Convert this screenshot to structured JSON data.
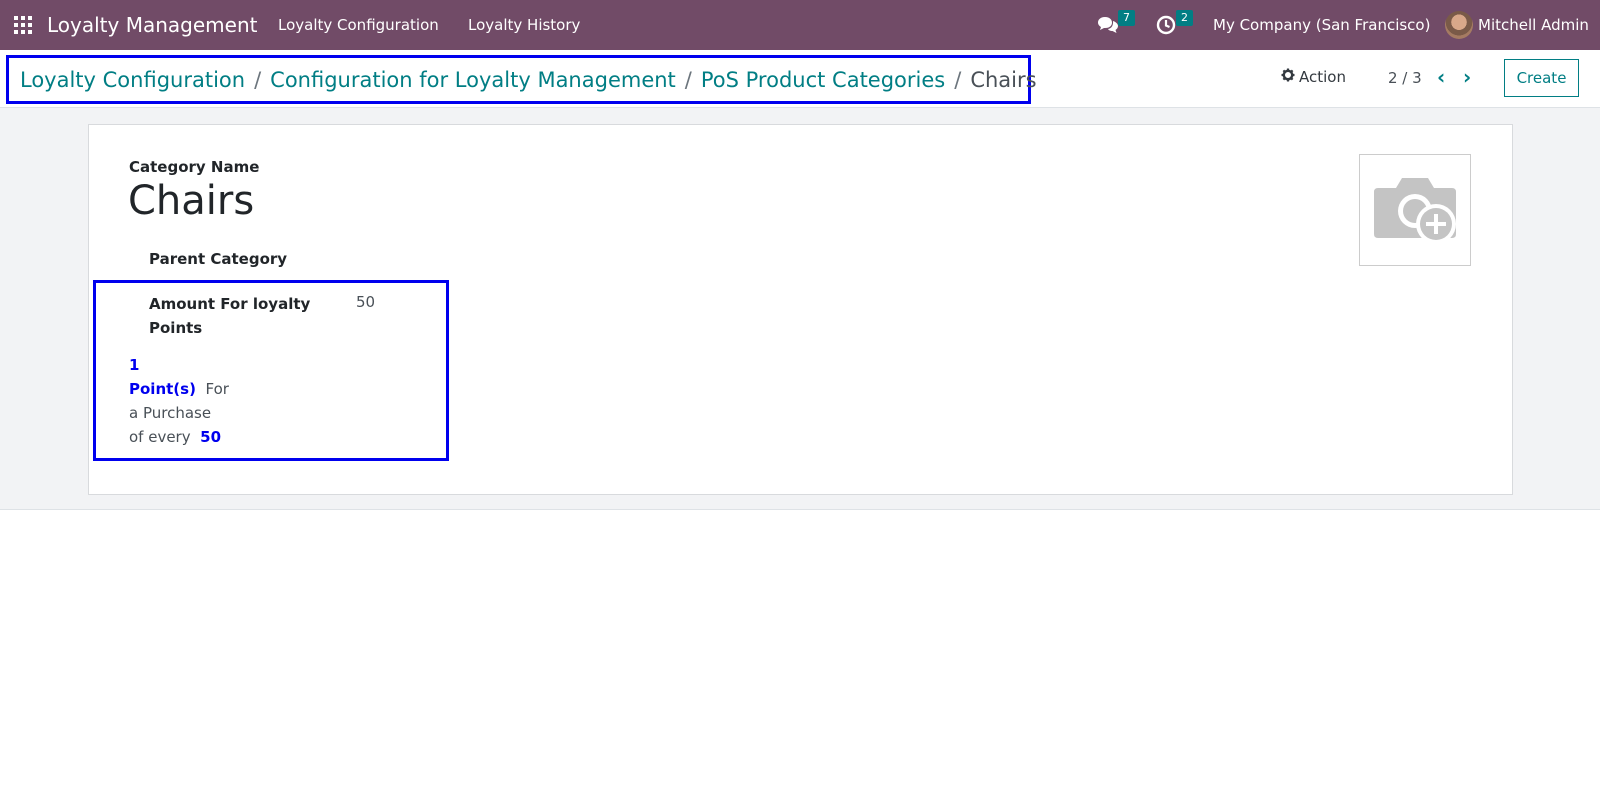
{
  "navbar": {
    "brand": "Loyalty Management",
    "menu": [
      "Loyalty Configuration",
      "Loyalty History"
    ],
    "messages_count": "7",
    "activities_count": "2",
    "company": "My Company (San Francisco)",
    "user": "Mitchell Admin"
  },
  "breadcrumb": {
    "items": [
      "Loyalty Configuration",
      "Configuration for Loyalty Management",
      "PoS Product Categories"
    ],
    "separator": "/",
    "current": "Chairs"
  },
  "control": {
    "action_label": "Action",
    "pager": "2 / 3",
    "create_label": "Create"
  },
  "form": {
    "category_name_label": "Category Name",
    "category_name": "Chairs",
    "parent_category_label": "Parent Category",
    "amount_label": "Amount For loyalty Points",
    "amount_value": "50",
    "points_count": "1",
    "points_unit": "Point(s)",
    "points_text_1": "For",
    "points_text_2": "a Purchase",
    "points_text_3": "of every",
    "points_amount": "50"
  },
  "colors": {
    "navbar": "#714b67",
    "accent": "#017e84",
    "highlight": "#0000ee"
  },
  "icons": [
    "apps-grid-icon",
    "chat-icon",
    "clock-icon",
    "gear-icon",
    "chevron-left-icon",
    "chevron-right-icon",
    "camera-plus-icon"
  ]
}
